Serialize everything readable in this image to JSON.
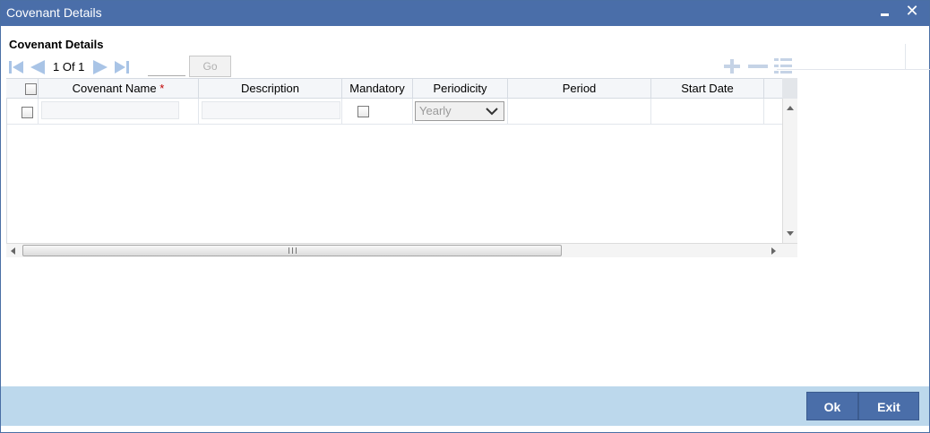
{
  "window": {
    "title": "Covenant Details"
  },
  "section": {
    "title": "Covenant Details"
  },
  "pager": {
    "text": "1 Of 1",
    "page_input_value": "",
    "go_label": "Go"
  },
  "table": {
    "columns": [
      {
        "label": "Covenant Name",
        "required_marker": "*"
      },
      {
        "label": "Description"
      },
      {
        "label": "Mandatory"
      },
      {
        "label": "Periodicity"
      },
      {
        "label": "Period"
      },
      {
        "label": "Start Date"
      }
    ],
    "rows": [
      {
        "covenant_name": "",
        "description": "",
        "mandatory": false,
        "periodicity": "Yearly",
        "period": "",
        "start_date": ""
      }
    ]
  },
  "footer": {
    "ok_label": "Ok",
    "exit_label": "Exit"
  },
  "colors": {
    "titlebar": "#4a6ea9",
    "footer_bg": "#bcd8ec",
    "button_bg": "#4a6ea9",
    "required": "#c00000"
  },
  "icons": {
    "minimize": "minimize-icon",
    "close": "close-icon",
    "first": "first-page-icon",
    "prev": "previous-page-icon",
    "next": "next-page-icon",
    "last": "last-page-icon",
    "add_row": "add-row-icon",
    "delete_row": "delete-row-icon",
    "single_view": "single-record-view-icon"
  }
}
